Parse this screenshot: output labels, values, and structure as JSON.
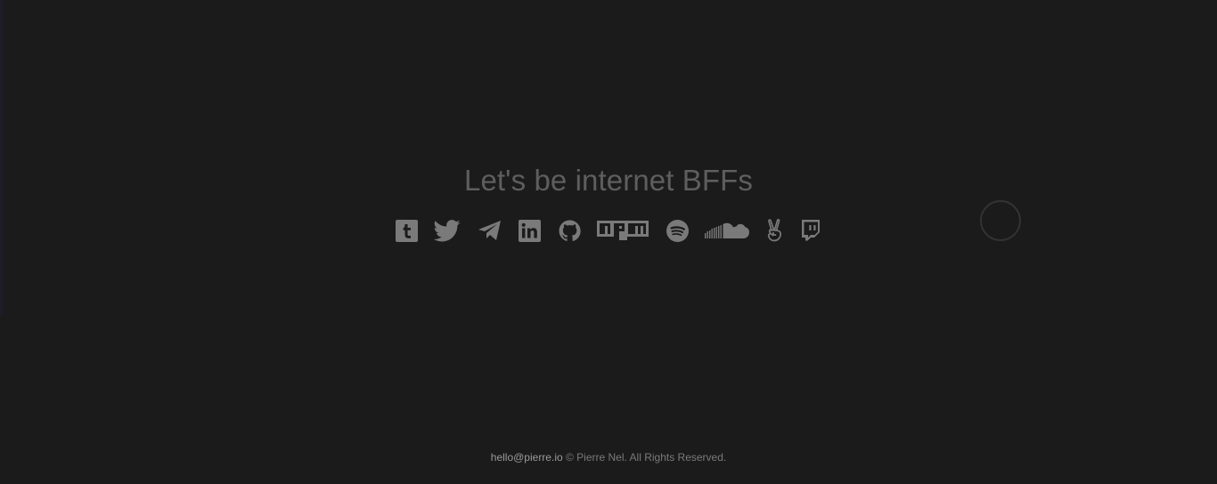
{
  "heading": "Let's be internet BFFs",
  "socials": [
    {
      "name": "Tumblr",
      "icon": "tumblr-icon"
    },
    {
      "name": "Twitter",
      "icon": "twitter-icon"
    },
    {
      "name": "Telegram",
      "icon": "telegram-icon"
    },
    {
      "name": "LinkedIn",
      "icon": "linkedin-icon"
    },
    {
      "name": "GitHub",
      "icon": "github-icon"
    },
    {
      "name": "npm",
      "icon": "npm-icon"
    },
    {
      "name": "Spotify",
      "icon": "spotify-icon"
    },
    {
      "name": "SoundCloud",
      "icon": "soundcloud-icon"
    },
    {
      "name": "AngelList",
      "icon": "angellist-icon"
    },
    {
      "name": "Twitch",
      "icon": "twitch-icon"
    }
  ],
  "footer": {
    "email": "hello@pierre.io",
    "copyright": " © Pierre Nel. All Rights Reserved."
  },
  "colors": {
    "background": "#1b1b1c",
    "heading": "#5e5e5e",
    "icon": "#7a7a7a",
    "footer_text": "#7a7a7a"
  }
}
